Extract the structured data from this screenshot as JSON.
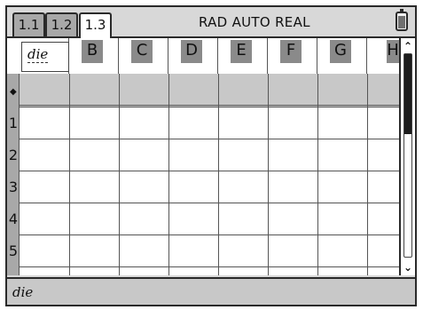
{
  "tabs": [
    {
      "label": "1.1"
    },
    {
      "label": "1.2"
    },
    {
      "label": "1.3"
    }
  ],
  "status": {
    "mode_text": "RAD AUTO REAL",
    "battery_icon": "battery-icon"
  },
  "sheet": {
    "cell_a_name": "die",
    "columns": [
      "B",
      "C",
      "D",
      "E",
      "F",
      "G",
      "H"
    ],
    "formula_row_marker": "◆",
    "rows": [
      "1",
      "2",
      "3",
      "4",
      "5"
    ]
  },
  "entry_line": {
    "value": "die"
  },
  "scrollbar": {
    "up_icon": "scroll-up-icon",
    "down_icon": "scroll-down-icon",
    "up_glyph": "⌃",
    "down_glyph": "⌄"
  }
}
